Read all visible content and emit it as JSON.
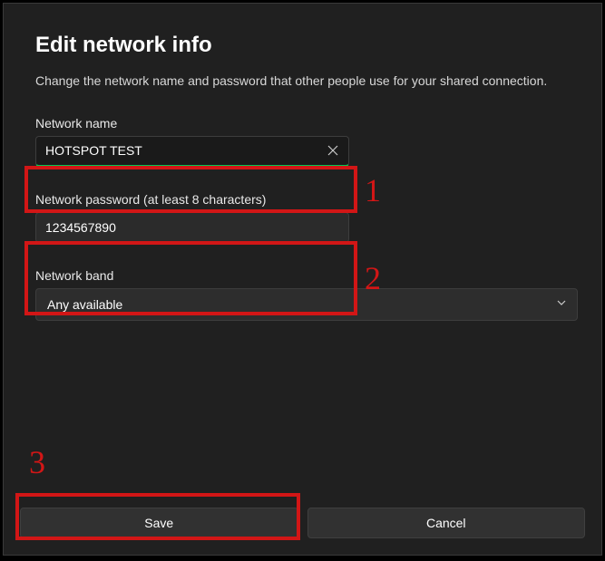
{
  "dialog": {
    "title": "Edit network info",
    "subtitle": "Change the network name and password that other people use for your shared connection."
  },
  "networkName": {
    "label": "Network name",
    "value": "HOTSPOT TEST"
  },
  "networkPassword": {
    "label": "Network password (at least 8 characters)",
    "value": "1234567890"
  },
  "networkBand": {
    "label": "Network band",
    "value": "Any available"
  },
  "buttons": {
    "save": "Save",
    "cancel": "Cancel"
  },
  "annotations": {
    "n1": "1",
    "n2": "2",
    "n3": "3"
  }
}
